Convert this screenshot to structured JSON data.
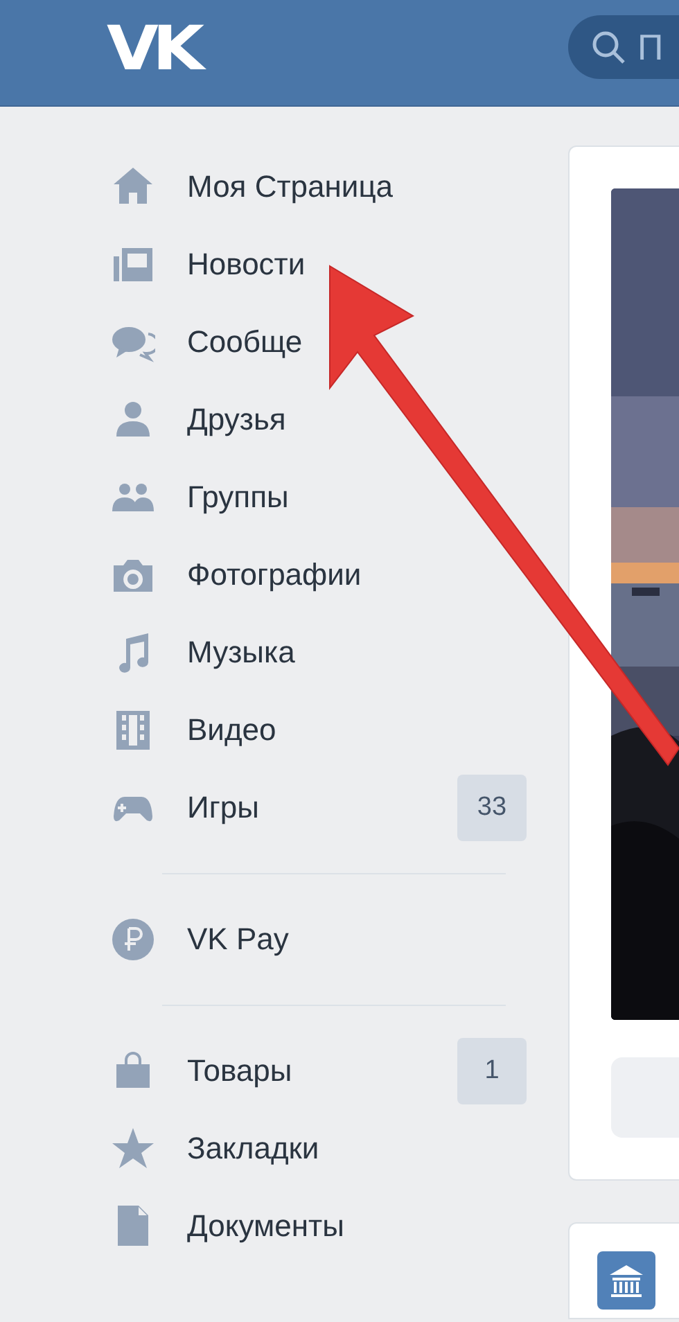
{
  "header": {
    "logo": "VK",
    "search": {
      "placeholder": "П"
    }
  },
  "sidebar": {
    "sections": [
      {
        "items": [
          {
            "label": "Моя Страница"
          },
          {
            "label": "Новости"
          },
          {
            "label": "Сообще"
          },
          {
            "label": "Друзья"
          },
          {
            "label": "Группы"
          },
          {
            "label": "Фотографии"
          },
          {
            "label": "Музыка"
          },
          {
            "label": "Видео"
          },
          {
            "label": "Игры",
            "badge": "33"
          }
        ]
      },
      {
        "items": [
          {
            "label": "VK Pay"
          }
        ]
      },
      {
        "items": [
          {
            "label": "Товары",
            "badge": "1"
          },
          {
            "label": "Закладки"
          },
          {
            "label": "Документы"
          }
        ]
      }
    ]
  }
}
